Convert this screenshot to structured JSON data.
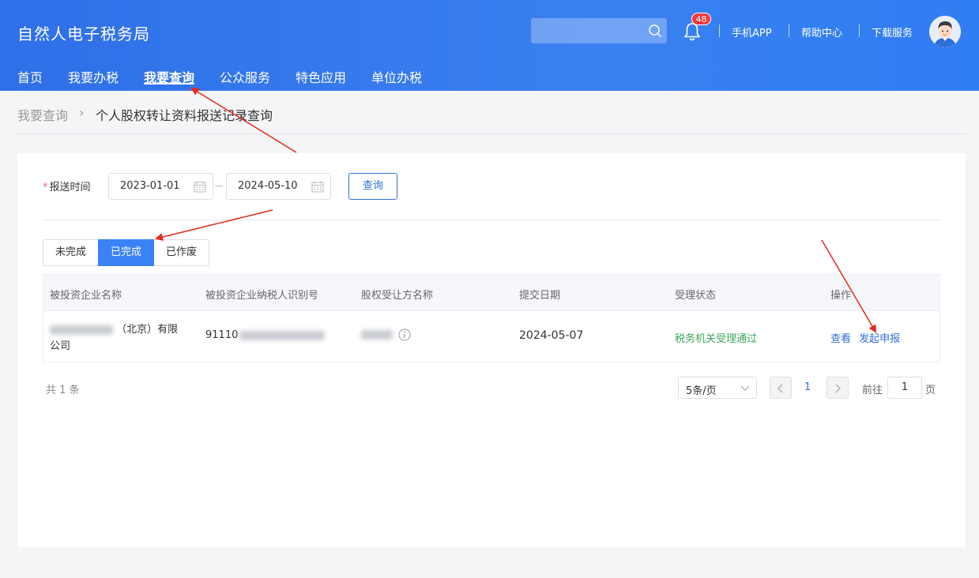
{
  "header": {
    "brand": "自然人电子税务局",
    "search_placeholder": "",
    "notification_count": "48",
    "links": [
      "手机APP",
      "帮助中心",
      "下载服务"
    ]
  },
  "nav": {
    "items": [
      "首页",
      "我要办税",
      "我要查询",
      "公众服务",
      "特色应用",
      "单位办税"
    ],
    "active": "我要查询"
  },
  "breadcrumb": {
    "parent": "我要查询",
    "separator": "›",
    "current": "个人股权转让资料报送记录查询"
  },
  "filter": {
    "label": "报送时间",
    "required_mark": "*",
    "start_date": "2023-01-01",
    "end_date": "2024-05-10",
    "query_button": "查询"
  },
  "tabs": {
    "items": [
      "未完成",
      "已完成",
      "已作废"
    ],
    "active": "已完成"
  },
  "table": {
    "columns": [
      "被投资企业名称",
      "被投资企业纳税人识别号",
      "股权受让方名称",
      "提交日期",
      "受理状态",
      "操作"
    ],
    "rows": [
      {
        "company_suffix": "（北京）有限",
        "company_line2": "公司",
        "tax_id_prefix": "91110",
        "submit_date": "2024-05-07",
        "status": "税务机关受理通过",
        "actions": [
          "查看",
          "发起申报"
        ]
      }
    ]
  },
  "pagination": {
    "total": "共 1 条",
    "page_size": "5条/页",
    "current_page": "1",
    "goto_label": "前往",
    "goto_value": "1",
    "page_suffix": "页"
  },
  "colors": {
    "header_blue": "#3a80f0",
    "accent_blue": "#3370d6",
    "status_green": "#3aa85a",
    "badge_red": "#f43838",
    "annotation_red": "#e8281e"
  }
}
